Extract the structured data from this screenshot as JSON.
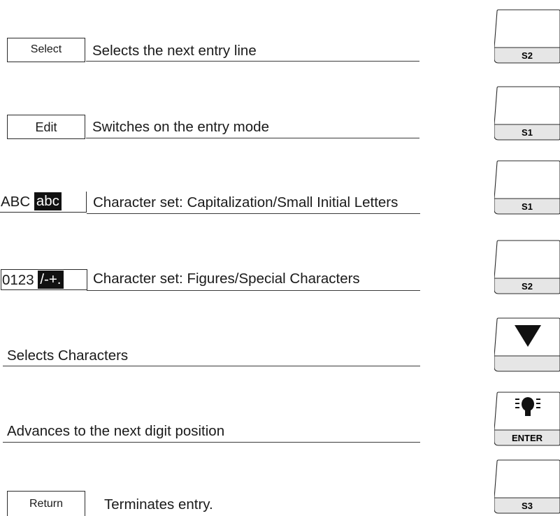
{
  "rows": [
    {
      "button": "Select",
      "description": "Selects the next entry line",
      "key": "S2"
    },
    {
      "button": "Edit",
      "description": "Switches on the entry mode",
      "key": "S1"
    },
    {
      "dual": {
        "normal": "ABC",
        "inverse": "abc"
      },
      "description": "Character set: Capitalization/Small Initial Letters",
      "key": "S1"
    },
    {
      "dual": {
        "normal": "0123",
        "inverse": "/-+."
      },
      "description": "Character set: Figures/Special Characters",
      "key": "S2"
    },
    {
      "description": "Selects Characters",
      "key": "down-arrow"
    },
    {
      "description": "Advances to the next digit position",
      "key": "ENTER"
    },
    {
      "button": "Return",
      "description": "Terminates entry.",
      "key": "S3"
    }
  ]
}
